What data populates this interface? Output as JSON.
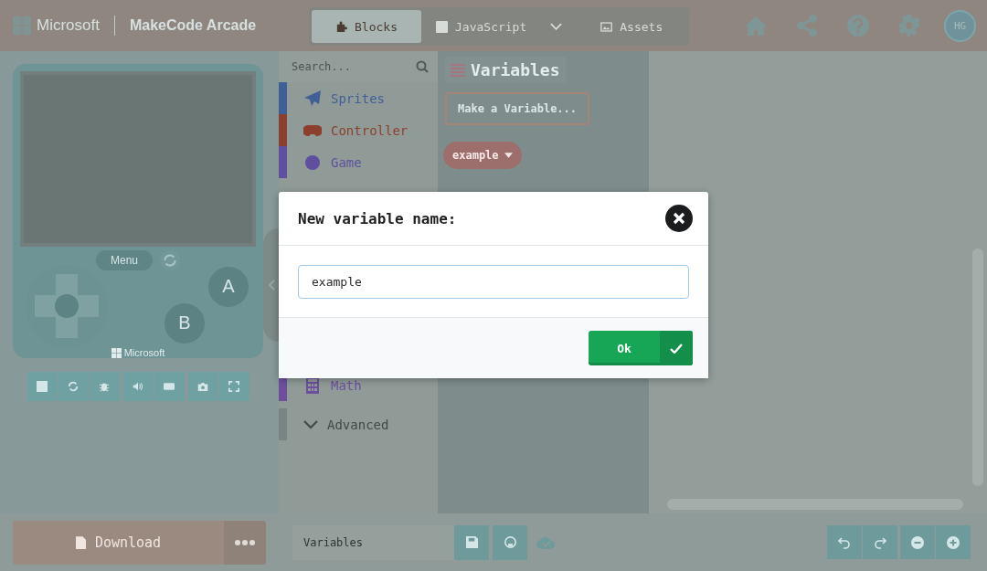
{
  "header": {
    "brand": "Microsoft",
    "product": "MakeCode Arcade",
    "avatar": "HG",
    "tabs": [
      {
        "label": "Blocks",
        "kind": "blocks",
        "selected": true
      },
      {
        "label": "JavaScript",
        "kind": "javascript",
        "selected": false
      },
      {
        "label": "Assets",
        "kind": "assets",
        "selected": false
      }
    ]
  },
  "simulator": {
    "menu": "Menu",
    "button_a": "A",
    "button_b": "B",
    "brand": "Microsoft"
  },
  "toolbox": {
    "search_placeholder": "Search...",
    "categories": [
      {
        "label": "Sprites",
        "kind": "plane",
        "color": "#3f5f96"
      },
      {
        "label": "Controller",
        "kind": "gamepad",
        "color": "#8c3f2c"
      },
      {
        "label": "Game",
        "kind": "circle",
        "color": "#5f4f9e"
      }
    ],
    "lower_categories": [
      {
        "label": "Math",
        "kind": "calculator",
        "color": "#6d4f9e"
      }
    ],
    "advanced": {
      "label": "Advanced"
    }
  },
  "flyout": {
    "title": "Variables",
    "make_button": "Make a Variable...",
    "variable_block": "example"
  },
  "dialog": {
    "title": "New variable name:",
    "value": "example",
    "ok": "Ok"
  },
  "footer": {
    "download": "Download",
    "project_name": "Variables"
  }
}
